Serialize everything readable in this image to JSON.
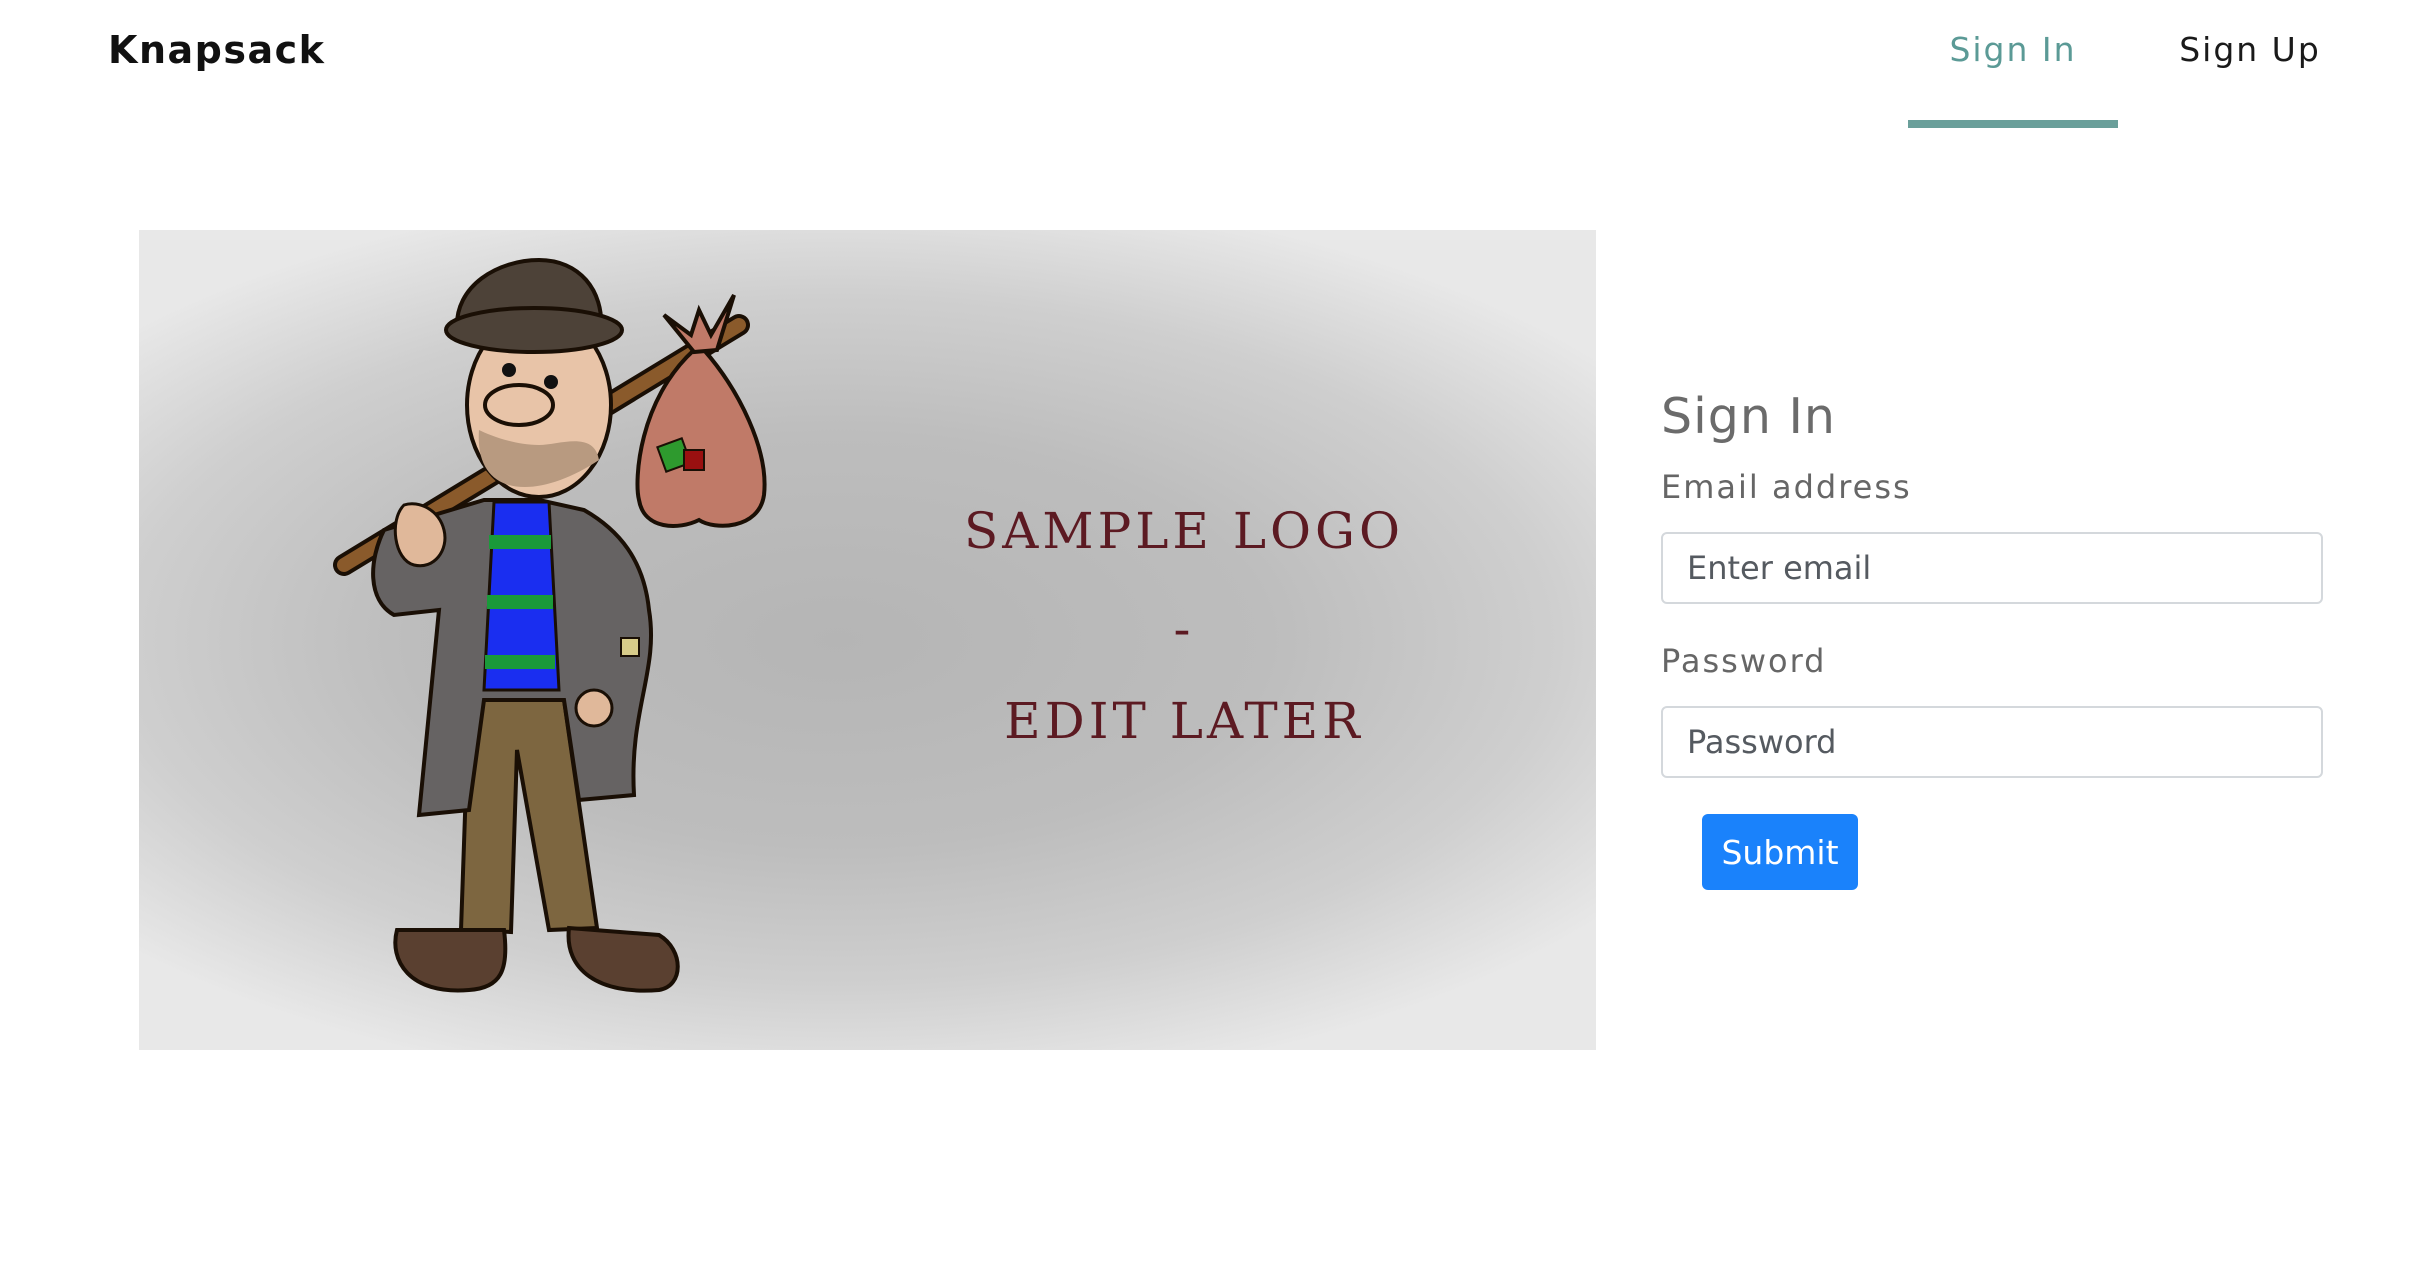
{
  "navbar": {
    "brand": "Knapsack",
    "links": [
      {
        "label": "Sign In",
        "active": true
      },
      {
        "label": "Sign Up",
        "active": false
      }
    ],
    "active_color": "#6a9f9a"
  },
  "hero": {
    "logo_lines": [
      "SAMPLE LOGO",
      "-",
      "EDIT LATER"
    ],
    "illustration": "hobo-with-bindle-illustration",
    "text_color": "#5c1a22"
  },
  "form": {
    "title": "Sign In",
    "email_label": "Email address",
    "email_placeholder": "Enter email",
    "email_value": "",
    "password_label": "Password",
    "password_placeholder": "Password",
    "password_value": "",
    "submit_label": "Submit",
    "submit_color": "#1a82fb"
  }
}
